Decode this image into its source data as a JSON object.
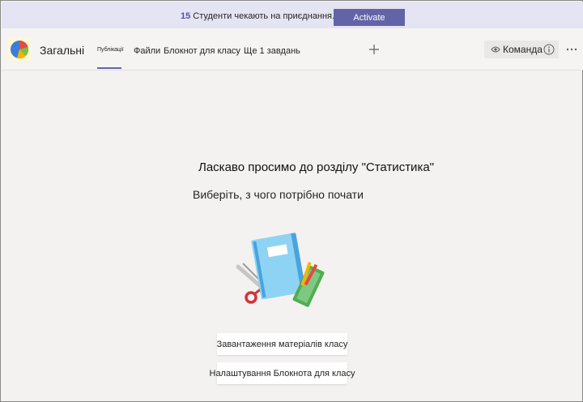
{
  "banner": {
    "count": "15",
    "message": "Студенти чекають на приєднання.",
    "activate_label": "Activate"
  },
  "header": {
    "channel_name": "Загальні",
    "tabs": [
      {
        "label": "Публікації",
        "active": true
      },
      {
        "label": "Файли",
        "active": false
      },
      {
        "label": "Блокнот для класу",
        "active": false
      },
      {
        "label": "Ще 1 завдань",
        "active": false
      }
    ],
    "add_tab_icon": "plus-icon",
    "team_label": "Команда",
    "more_icon": "more-icon"
  },
  "main": {
    "title": "Ласкаво просимо до розділу \"Статистика\"",
    "subtitle": "Виберіть, з чого потрібно почати",
    "buttons": [
      {
        "label": "Завантаження матеріалів класу"
      },
      {
        "label": "Налаштування Блокнота для класу"
      }
    ]
  },
  "colors": {
    "accent": "#6264a7",
    "banner_bg": "#e5e4f2",
    "page_bg": "#f3f2f1"
  }
}
